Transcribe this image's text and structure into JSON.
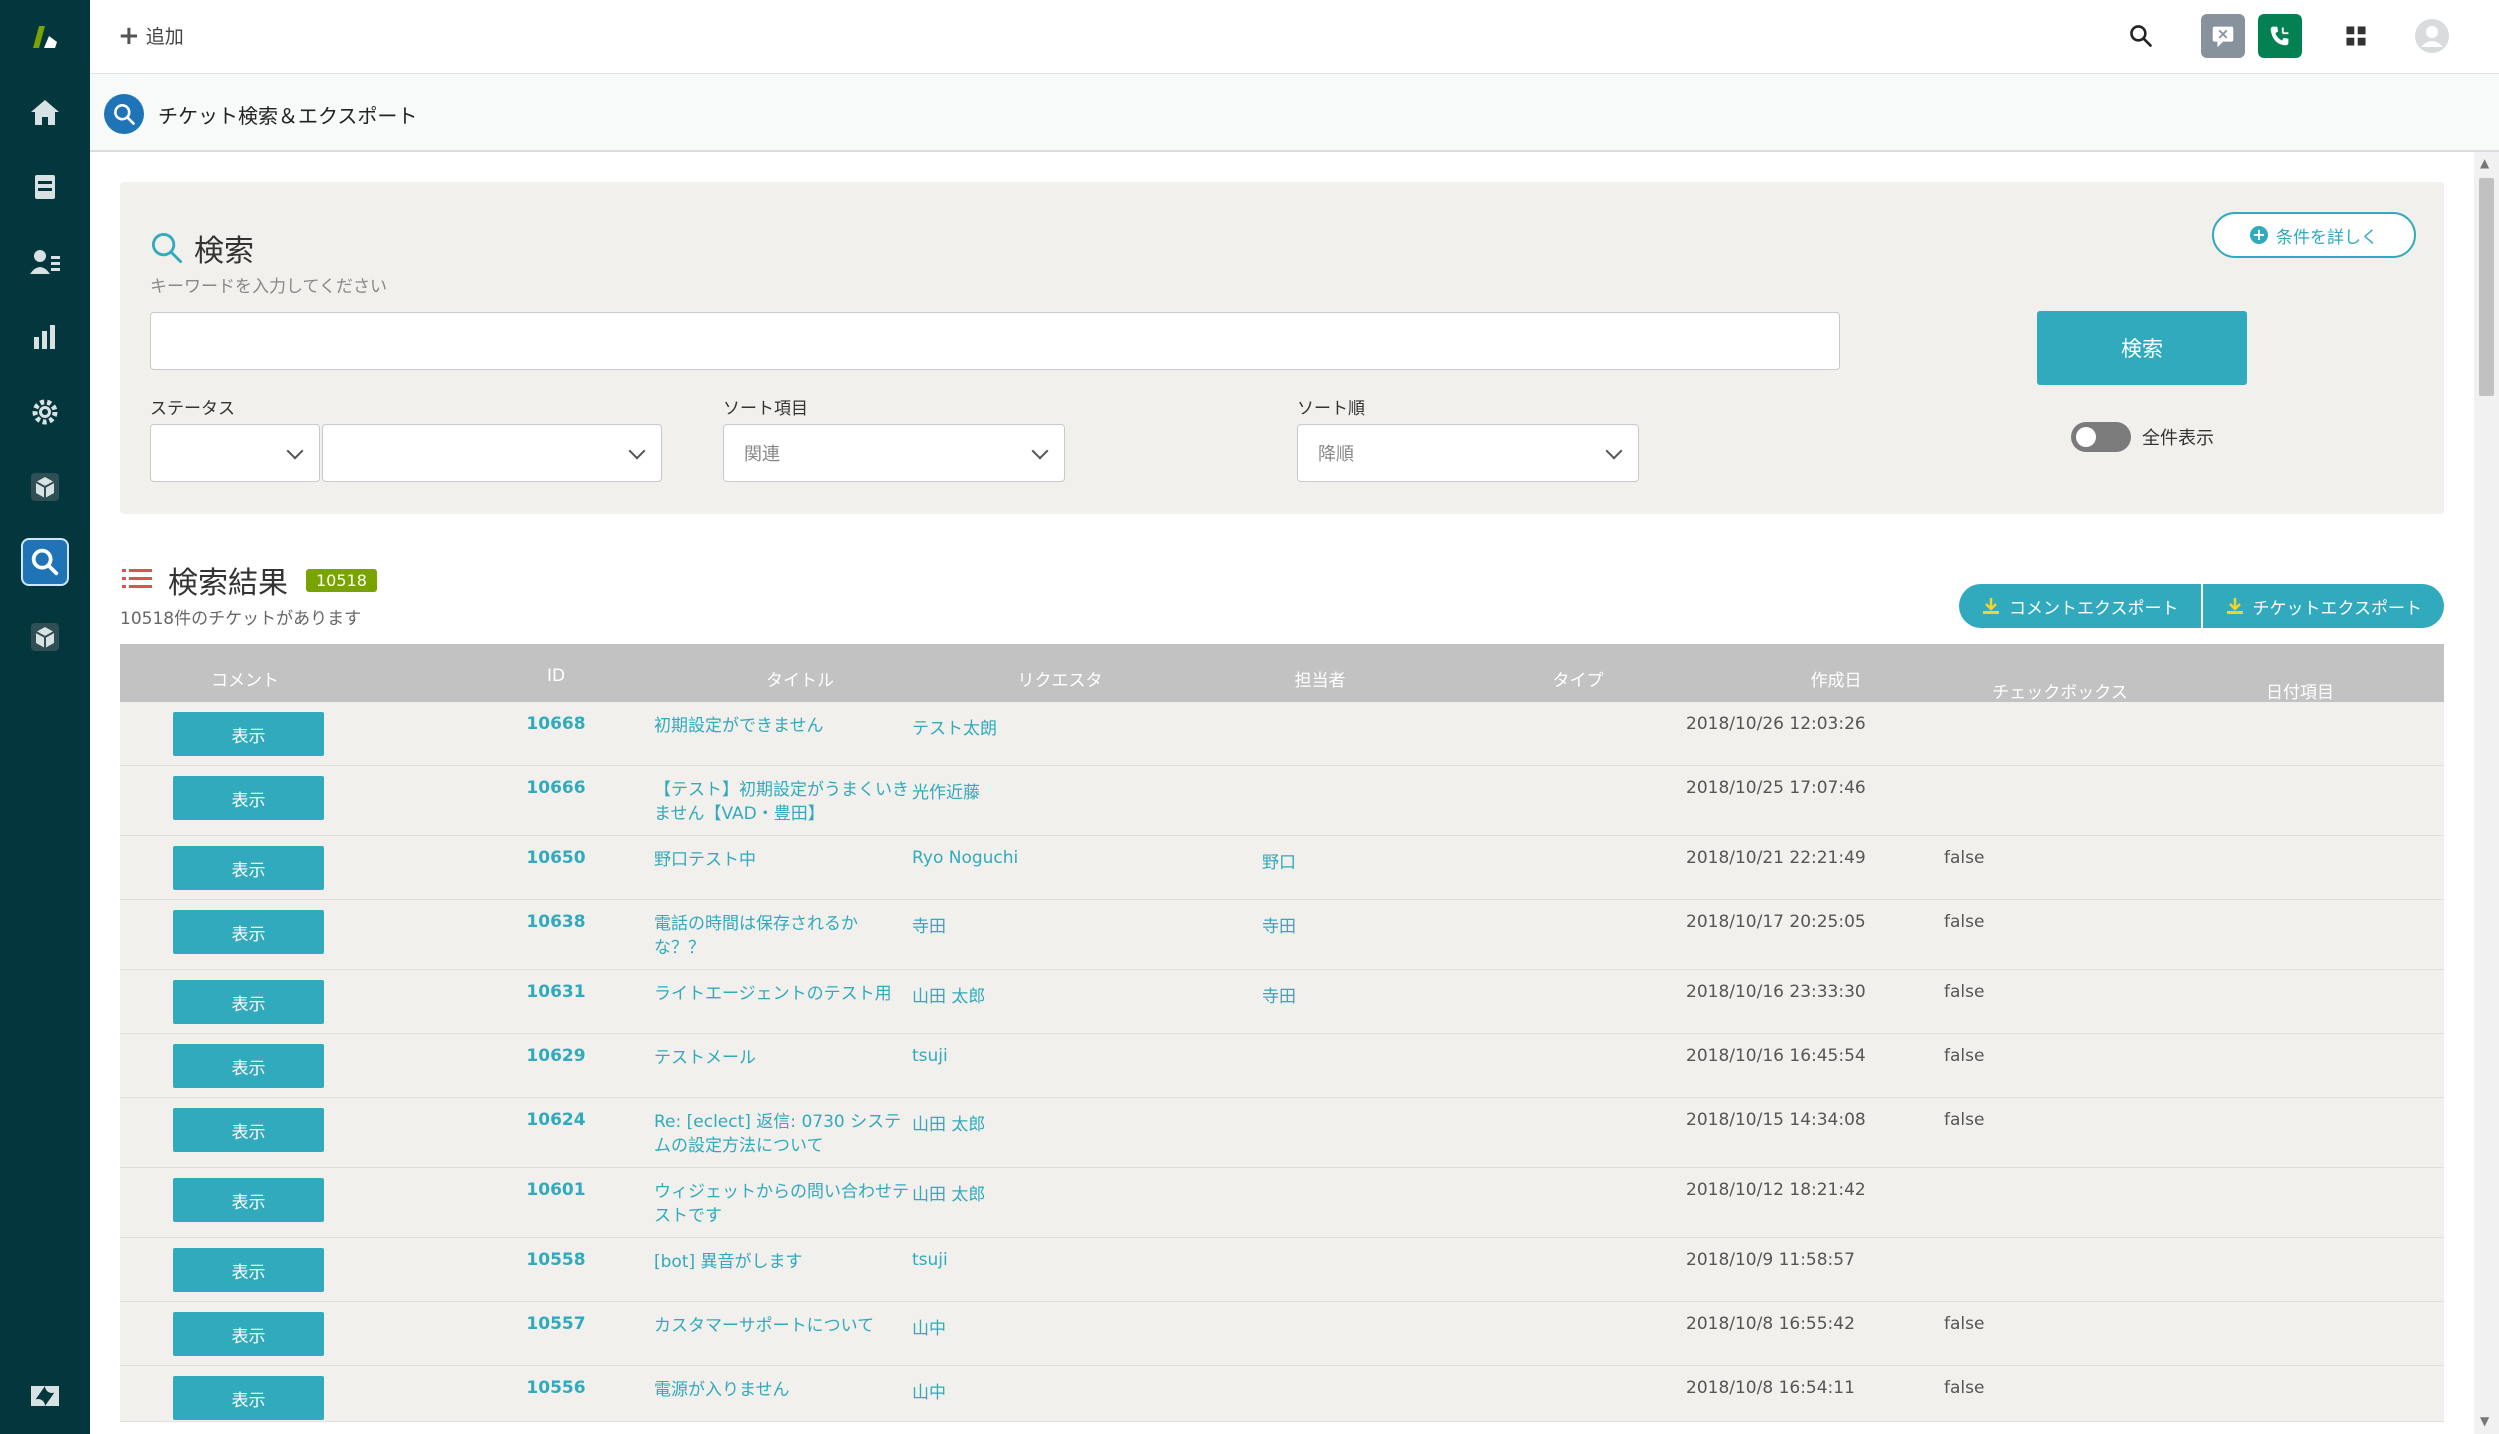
{
  "topbar": {
    "add_label": "追加"
  },
  "app": {
    "title": "チケット検索＆エクスポート"
  },
  "search": {
    "title": "検索",
    "subtitle": "キーワードを入力してください",
    "input_value": "",
    "button_label": "検索",
    "detail_label": "条件を詳しく",
    "status_label": "ステータス",
    "status_value_1": "",
    "status_value_2": "",
    "sort_field_label": "ソート項目",
    "sort_field_value": "関連",
    "sort_order_label": "ソート順",
    "sort_order_value": "降順",
    "toggle_label": "全件表示"
  },
  "results": {
    "title": "検索結果",
    "count": "10518",
    "summary": "10518件のチケットがあります",
    "export_comments": "コメントエクスポート",
    "export_tickets": "チケットエクスポート",
    "columns": [
      "コメント",
      "ID",
      "タイトル",
      "リクエスタ",
      "担当者",
      "タイプ",
      "作成日",
      "チェックボックス",
      "日付項目"
    ],
    "view_label": "表示",
    "rows": [
      {
        "id": "10668",
        "title": [
          "初期設定ができません"
        ],
        "requester": "テスト太朗",
        "assignee": "",
        "created": "2018/10/26 12:03:26",
        "checkbox": ""
      },
      {
        "id": "10666",
        "title": [
          "【テスト】初期設定がうまくいき",
          "ません【VAD・豊田】"
        ],
        "requester": "光作近藤",
        "assignee": "",
        "created": "2018/10/25 17:07:46",
        "checkbox": ""
      },
      {
        "id": "10650",
        "title": [
          "野口テスト中"
        ],
        "requester": "Ryo Noguchi",
        "assignee": "野口",
        "created": "2018/10/21 22:21:49",
        "checkbox": "false"
      },
      {
        "id": "10638",
        "title": [
          "電話の時間は保存されるか",
          "な？？"
        ],
        "requester": "寺田",
        "assignee": "寺田",
        "created": "2018/10/17 20:25:05",
        "checkbox": "false"
      },
      {
        "id": "10631",
        "title": [
          "ライトエージェントのテスト用"
        ],
        "requester": "山田 太郎",
        "assignee": "寺田",
        "created": "2018/10/16 23:33:30",
        "checkbox": "false"
      },
      {
        "id": "10629",
        "title": [
          "テストメール"
        ],
        "requester": "tsuji",
        "assignee": "",
        "created": "2018/10/16 16:45:54",
        "checkbox": "false"
      },
      {
        "id": "10624",
        "title": [
          "Re: [eclect] 返信: 0730 システ",
          "ムの設定方法について"
        ],
        "requester": "山田 太郎",
        "assignee": "",
        "created": "2018/10/15 14:34:08",
        "checkbox": "false"
      },
      {
        "id": "10601",
        "title": [
          "ウィジェットからの問い合わせテ",
          "ストです"
        ],
        "requester": "山田 太郎",
        "assignee": "",
        "created": "2018/10/12 18:21:42",
        "checkbox": ""
      },
      {
        "id": "10558",
        "title": [
          "[bot] 異音がします"
        ],
        "requester": "tsuji",
        "assignee": "",
        "created": "2018/10/9 11:58:57",
        "checkbox": ""
      },
      {
        "id": "10557",
        "title": [
          "カスタマーサポートについて"
        ],
        "requester": "山中",
        "assignee": "",
        "created": "2018/10/8 16:55:42",
        "checkbox": "false"
      },
      {
        "id": "10556",
        "title": [
          "電源が入りません"
        ],
        "requester": "山中",
        "assignee": "",
        "created": "2018/10/8 16:54:11",
        "checkbox": "false"
      }
    ]
  },
  "colors": {
    "accent": "#30aabc",
    "nav": "#03363d",
    "badge": "#78a300"
  },
  "icons": {
    "nav": [
      "zendesk-logo-icon",
      "home-icon",
      "views-icon",
      "customers-icon",
      "reporting-icon",
      "admin-gear-icon",
      "app-box-icon",
      "search-app-icon",
      "app-box-icon",
      "zendesk-z-icon"
    ],
    "top": [
      "search-icon",
      "chat-icon",
      "talk-phone-icon",
      "apps-grid-icon",
      "user-avatar-icon"
    ]
  }
}
